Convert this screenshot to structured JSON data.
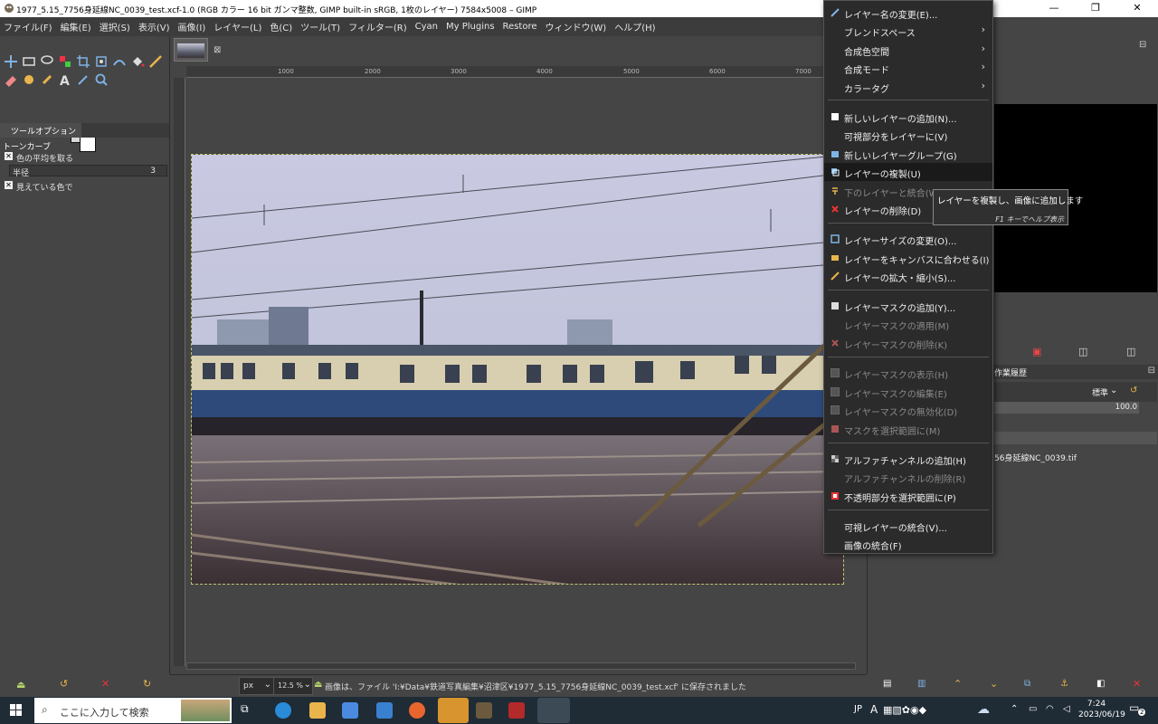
{
  "window": {
    "title": "1977_5.15_7756身延線NC_0039_test.xcf-1.0 (RGB カラー 16 bit ガンマ整数, GIMP built-in sRGB, 1枚のレイヤー) 7584x5008 – GIMP",
    "minimize": "—",
    "maximize": "❐",
    "close": "✕"
  },
  "menubar": {
    "items": [
      "ファイル(F)",
      "編集(E)",
      "選択(S)",
      "表示(V)",
      "画像(I)",
      "レイヤー(L)",
      "色(C)",
      "ツール(T)",
      "フィルター(R)",
      "Cyan",
      "My Plugins",
      "Restore",
      "ウィンドウ(W)",
      "ヘルプ(H)"
    ]
  },
  "tool_options": {
    "tab_title": "ツールオプション",
    "tool_name": "トーンカーブ",
    "sample_average": "色の平均を取る",
    "radius_label": "半径",
    "radius_value": "3",
    "sample_merged": "見えている色で"
  },
  "rulers": {
    "h_ticks": [
      "1000",
      "2000",
      "3000",
      "4000",
      "5000",
      "6000",
      "7000"
    ]
  },
  "statusbar": {
    "unit": "px",
    "zoom": "12.5 %",
    "message": "画像は、ファイル 'I:¥Data¥鉄道写真編集¥沼津区¥1977_5.15_7756身延線NC_0039_test.xcf' に保存されました"
  },
  "right_panel": {
    "tab_history": "作業履歴",
    "mode": "標準",
    "opacity": "100.0",
    "layer_name": "56身延線NC_0039.tif"
  },
  "context_menu": {
    "items": [
      {
        "label": "レイヤー名の変更(E)...",
        "icon": "pencil-icon",
        "disabled": false,
        "submenu": false
      },
      {
        "label": "ブレンドスペース",
        "icon": "",
        "disabled": false,
        "submenu": true
      },
      {
        "label": "合成色空間",
        "icon": "",
        "disabled": false,
        "submenu": true
      },
      {
        "label": "合成モード",
        "icon": "",
        "disabled": false,
        "submenu": true
      },
      {
        "label": "カラータグ",
        "icon": "",
        "disabled": false,
        "submenu": true
      },
      {
        "label": "新しいレイヤーの追加(N)...",
        "icon": "new-layer-icon",
        "disabled": false,
        "submenu": false
      },
      {
        "label": "可視部分をレイヤーに(V)",
        "icon": "",
        "disabled": false,
        "submenu": false
      },
      {
        "label": "新しいレイヤーグループ(G)",
        "icon": "layer-group-icon",
        "disabled": false,
        "submenu": false
      },
      {
        "label": "レイヤーの複製(U)",
        "icon": "duplicate-layer-icon",
        "disabled": false,
        "submenu": false,
        "highlighted": true
      },
      {
        "label": "下のレイヤーと統合(W)",
        "icon": "merge-down-icon",
        "disabled": true,
        "submenu": false
      },
      {
        "label": "レイヤーの削除(D)",
        "icon": "delete-icon",
        "disabled": false,
        "submenu": false
      },
      {
        "label": "レイヤーサイズの変更(O)...",
        "icon": "layer-size-icon",
        "disabled": false,
        "submenu": false
      },
      {
        "label": "レイヤーをキャンバスに合わせる(I)",
        "icon": "layer-to-canvas-icon",
        "disabled": false,
        "submenu": false
      },
      {
        "label": "レイヤーの拡大・縮小(S)...",
        "icon": "scale-layer-icon",
        "disabled": false,
        "submenu": false
      },
      {
        "label": "レイヤーマスクの追加(Y)...",
        "icon": "add-mask-icon",
        "disabled": false,
        "submenu": false
      },
      {
        "label": "レイヤーマスクの適用(M)",
        "icon": "",
        "disabled": true,
        "submenu": false
      },
      {
        "label": "レイヤーマスクの削除(K)",
        "icon": "delete-mask-icon",
        "disabled": true,
        "submenu": false
      },
      {
        "label": "レイヤーマスクの表示(H)",
        "icon": "checkbox-icon",
        "disabled": true,
        "submenu": false
      },
      {
        "label": "レイヤーマスクの編集(E)",
        "icon": "checkbox-icon",
        "disabled": true,
        "submenu": false
      },
      {
        "label": "レイヤーマスクの無効化(D)",
        "icon": "checkbox-icon",
        "disabled": true,
        "submenu": false
      },
      {
        "label": "マスクを選択範囲に(M)",
        "icon": "mask-to-selection-icon",
        "disabled": true,
        "submenu": false
      },
      {
        "label": "アルファチャンネルの追加(H)",
        "icon": "alpha-icon",
        "disabled": false,
        "submenu": false
      },
      {
        "label": "アルファチャンネルの削除(R)",
        "icon": "",
        "disabled": true,
        "submenu": false
      },
      {
        "label": "不透明部分を選択範囲に(P)",
        "icon": "alpha-to-selection-icon",
        "disabled": false,
        "submenu": false
      },
      {
        "label": "可視レイヤーの統合(V)...",
        "icon": "",
        "disabled": false,
        "submenu": false
      },
      {
        "label": "画像の統合(F)",
        "icon": "",
        "disabled": false,
        "submenu": false
      }
    ]
  },
  "tooltip": {
    "text": "レイヤーを複製し、画像に追加します",
    "help": "F1 キーでヘルプ表示"
  },
  "taskbar": {
    "search_placeholder": "ここに入力して検索",
    "ime": "JP",
    "ime_mode": "A",
    "time": "7:24",
    "date": "2023/06/19",
    "notifications": "2"
  }
}
